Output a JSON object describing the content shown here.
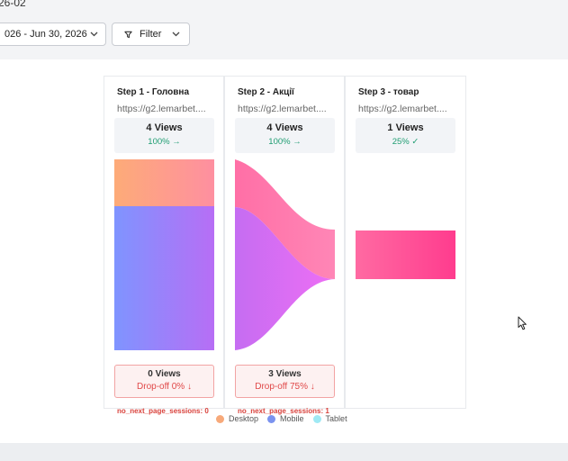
{
  "header": {
    "crumb": "26-02",
    "date_range": "026 - Jun 30, 2026",
    "filter_label": "Filter"
  },
  "steps": [
    {
      "title": "Step 1 - Головна",
      "url": "https://g2.lemarbet....",
      "views": "4 Views",
      "pct": "100% →",
      "drop_views": "0 Views",
      "drop_pct": "Drop-off 0% ↓",
      "no_next": "no_next_page_sessions: 0"
    },
    {
      "title": "Step 2 - Акції",
      "url": "https://g2.lemarbet....",
      "views": "4 Views",
      "pct": "100% →",
      "drop_views": "3 Views",
      "drop_pct": "Drop-off 75% ↓",
      "no_next": "no_next_page_sessions: 1"
    },
    {
      "title": "Step 3 - товар",
      "url": "https://g2.lemarbet....",
      "views": "1 Views",
      "pct": "25% ✓"
    }
  ],
  "legend": [
    {
      "label": "Desktop",
      "color": "#f7a97a"
    },
    {
      "label": "Mobile",
      "color": "#7b93ef"
    },
    {
      "label": "Tablet",
      "color": "#9fe9f4"
    }
  ],
  "colors": {
    "desktop_start": "#fdab78",
    "desktop_end": "#fe8fa0",
    "mobile_start": "#7f94ff",
    "mobile_end": "#b76ef5",
    "pink_start": "#ff6fa6",
    "pink_end": "#ff86b6",
    "purple_start": "#c56df2",
    "purple_end": "#ee6ef4",
    "step3_start": "#ff6aa2",
    "step3_end": "#ff3c8e",
    "success": "#1f9d72",
    "danger": "#e04848"
  }
}
